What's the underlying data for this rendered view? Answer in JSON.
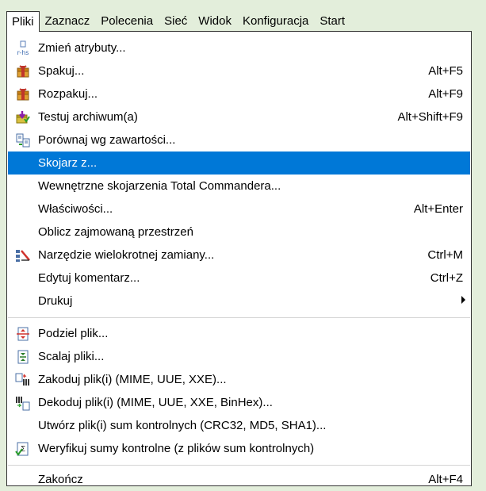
{
  "menubar": {
    "items": [
      "Pliki",
      "Zaznacz",
      "Polecenia",
      "Sieć",
      "Widok",
      "Konfiguracja",
      "Start"
    ]
  },
  "menu": {
    "items": [
      {
        "label": "Zmień atrybuty...",
        "shortcut": "",
        "icon": "attributes-icon"
      },
      {
        "label": "Spakuj...",
        "shortcut": "Alt+F5",
        "icon": "pack-icon"
      },
      {
        "label": "Rozpakuj...",
        "shortcut": "Alt+F9",
        "icon": "unpack-icon"
      },
      {
        "label": "Testuj archiwum(a)",
        "shortcut": "Alt+Shift+F9",
        "icon": "test-archive-icon"
      },
      {
        "label": "Porównaj wg zawartości...",
        "shortcut": "",
        "icon": "compare-icon"
      },
      {
        "label": "Skojarz z...",
        "shortcut": "",
        "icon": ""
      },
      {
        "label": "Wewnętrzne skojarzenia Total Commandera...",
        "shortcut": "",
        "icon": ""
      },
      {
        "label": "Właściwości...",
        "shortcut": "Alt+Enter",
        "icon": ""
      },
      {
        "label": "Oblicz zajmowaną przestrzeń",
        "shortcut": "",
        "icon": ""
      },
      {
        "label": "Narzędzie wielokrotnej zamiany...",
        "shortcut": "Ctrl+M",
        "icon": "multi-rename-icon"
      },
      {
        "label": "Edytuj komentarz...",
        "shortcut": "Ctrl+Z",
        "icon": ""
      },
      {
        "label": "Drukuj",
        "shortcut": "",
        "icon": ""
      },
      {
        "label": "Podziel plik...",
        "shortcut": "",
        "icon": "split-file-icon"
      },
      {
        "label": "Scalaj pliki...",
        "shortcut": "",
        "icon": "combine-files-icon"
      },
      {
        "label": "Zakoduj plik(i) (MIME, UUE, XXE)...",
        "shortcut": "",
        "icon": "encode-icon"
      },
      {
        "label": "Dekoduj plik(i) (MIME, UUE, XXE, BinHex)...",
        "shortcut": "",
        "icon": "decode-icon"
      },
      {
        "label": "Utwórz plik(i) sum kontrolnych (CRC32, MD5, SHA1)...",
        "shortcut": "",
        "icon": ""
      },
      {
        "label": "Weryfikuj sumy kontrolne (z plików sum kontrolnych)",
        "shortcut": "",
        "icon": "verify-checksum-icon"
      },
      {
        "label": "Zakończ",
        "shortcut": "Alt+F4",
        "icon": ""
      }
    ]
  },
  "colors": {
    "background": "#e3eedb",
    "selection": "#0078d7",
    "menu_bg": "#ffffff"
  }
}
